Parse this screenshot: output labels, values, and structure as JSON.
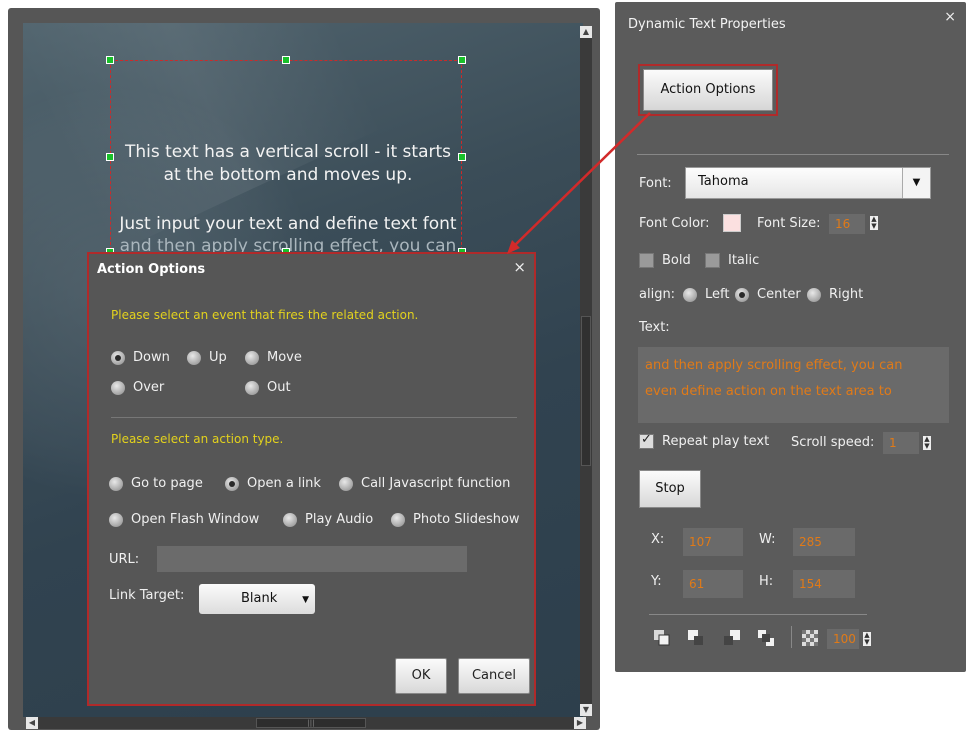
{
  "canvas": {
    "scroll_text_line1": "This text has a vertical scroll - it starts",
    "scroll_text_line2": "at the bottom and moves up.",
    "scroll_text_line3": "Just input your text and define text font",
    "scroll_text_line4": "and then apply scrolling effect, you can"
  },
  "dialog": {
    "title": "Action Options",
    "close": "×",
    "event_prompt": "Please select an event that fires the related action.",
    "events": [
      {
        "label": "Down",
        "checked": true
      },
      {
        "label": "Up",
        "checked": false
      },
      {
        "label": "Move",
        "checked": false
      },
      {
        "label": "Over",
        "checked": false
      },
      {
        "label": "Out",
        "checked": false
      }
    ],
    "action_prompt": "Please select an action type.",
    "actions": [
      {
        "label": "Go to page",
        "checked": false
      },
      {
        "label": "Open a link",
        "checked": true
      },
      {
        "label": "Call Javascript function",
        "checked": false
      },
      {
        "label": "Open Flash Window",
        "checked": false
      },
      {
        "label": "Play Audio",
        "checked": false
      },
      {
        "label": "Photo Slideshow",
        "checked": false
      }
    ],
    "url_label": "URL:",
    "url_value": "",
    "link_target_label": "Link Target:",
    "link_target_value": "Blank",
    "ok_label": "OK",
    "cancel_label": "Cancel"
  },
  "panel": {
    "title": "Dynamic Text Properties",
    "close": "×",
    "action_options_label": "Action Options",
    "font_label": "Font:",
    "font_value": "Tahoma",
    "font_color_label": "Font Color:",
    "font_color": "#fbe0e0",
    "font_size_label": "Font Size:",
    "font_size_value": "16",
    "bold_label": "Bold",
    "italic_label": "Italic",
    "align_label": "align:",
    "align_left": "Left",
    "align_center": "Center",
    "align_right": "Right",
    "align_selected": "Center",
    "text_label": "Text:",
    "text_line1": "and then apply scrolling effect, you can",
    "text_line2": "even define action on the text area to",
    "repeat_label": "Repeat play text",
    "repeat_checked": true,
    "scroll_speed_label": "Scroll speed:",
    "scroll_speed_value": "1",
    "stop_label": "Stop",
    "x_label": "X:",
    "x_value": "107",
    "w_label": "W:",
    "w_value": "285",
    "y_label": "Y:",
    "y_value": "61",
    "h_label": "H:",
    "h_value": "154",
    "opacity_value": "100"
  },
  "colors": {
    "accent_red": "#b02a2a",
    "value_orange": "#e07a18",
    "prompt_yellow": "#e3d21d",
    "handle_green": "#19c02a"
  }
}
